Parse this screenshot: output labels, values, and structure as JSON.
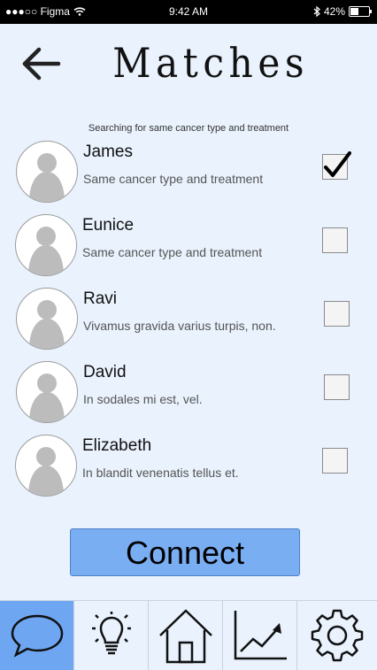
{
  "status": {
    "carrier": "●●●○○ Figma",
    "time": "9:42 AM",
    "battery": "42%"
  },
  "header": {
    "title": "Matches",
    "subtitle": "Searching for same cancer type and treatment"
  },
  "matches": [
    {
      "name": "James",
      "desc": "Same cancer type and treatment",
      "checked": true
    },
    {
      "name": "Eunice",
      "desc": "Same cancer type and treatment",
      "checked": false
    },
    {
      "name": "Ravi",
      "desc": "Vivamus gravida varius turpis, non.",
      "checked": false
    },
    {
      "name": "David",
      "desc": "In sodales mi est, vel.",
      "checked": false
    },
    {
      "name": "Elizabeth",
      "desc": "In blandit venenatis tellus et.",
      "checked": false
    }
  ],
  "actions": {
    "connect_label": "Connect"
  },
  "tabbar": {
    "tabs": [
      {
        "icon": "chat-bubble-icon",
        "active": true
      },
      {
        "icon": "lightbulb-icon",
        "active": false
      },
      {
        "icon": "home-icon",
        "active": false
      },
      {
        "icon": "chart-trend-icon",
        "active": false
      },
      {
        "icon": "gear-icon",
        "active": false
      }
    ]
  },
  "colors": {
    "background": "#e9f2fd",
    "accent": "#7aaef3",
    "active_tab": "#6fa6f2"
  }
}
